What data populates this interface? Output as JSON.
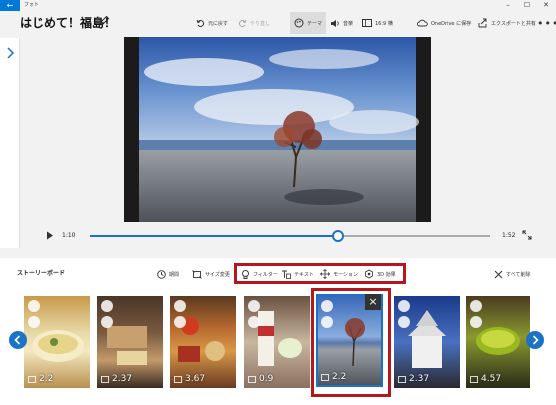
{
  "window": {
    "app_title": "フォト",
    "back_icon": "back-arrow-icon",
    "minimize": "–",
    "maximize": "☐",
    "close": "✕"
  },
  "header": {
    "project_title": "はじめて！福島！",
    "undo_label": "元に戻す",
    "redo_label": "やり直し",
    "theme_label": "テーマ",
    "music_label": "音楽",
    "aspect_label": "16:9 横",
    "onedrive_label": "OneDrive に保存",
    "export_label": "エクスポートと共有",
    "more_label": "•••"
  },
  "playback": {
    "current_time": "1:10",
    "total_time": "1:52",
    "progress_fraction": 0.62
  },
  "storyboard": {
    "label": "ストーリーボード",
    "tools": {
      "duration": "期間",
      "resize": "サイズ変更",
      "filter": "フィルター",
      "text": "テキスト",
      "motion": "モーション",
      "effects3d": "3D 効果",
      "remove_all": "すべて削除"
    },
    "clips": [
      {
        "duration": "2.2",
        "image": "chawanmushi-bowl"
      },
      {
        "duration": "2.37",
        "image": "grilled-fish-dish"
      },
      {
        "duration": "3.67",
        "image": "assorted-food-tray"
      },
      {
        "duration": "0.9",
        "image": "sake-bottle-and-dumpling"
      },
      {
        "duration": "2.2",
        "image": "beach-tree-selected"
      },
      {
        "duration": "2.37",
        "image": "castle-tower"
      },
      {
        "duration": "4.57",
        "image": "green-tea-cup"
      }
    ]
  },
  "colors": {
    "accent": "#1a73c9",
    "highlight": "#b3181e",
    "titlebar_accent": "#0078d7"
  }
}
